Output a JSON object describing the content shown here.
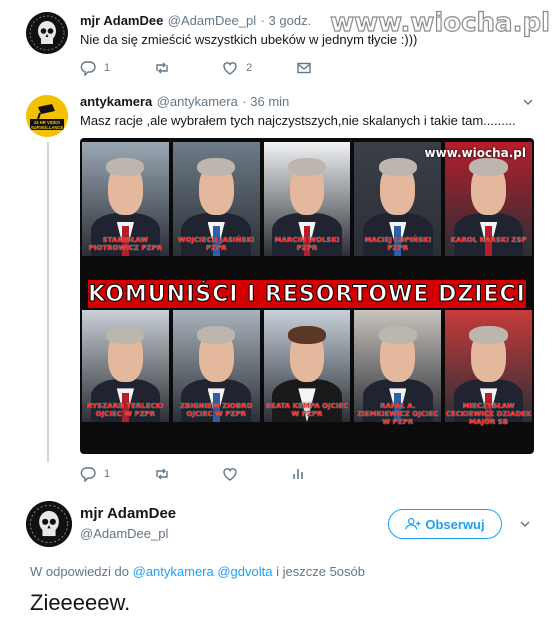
{
  "watermark": "www.wiocha.pl",
  "tweet1": {
    "name": "mjr AdamDee",
    "handle": "@AdamDee_pl",
    "time": "· 3 godz.",
    "text": "Nie da się zmieścić wszystkich ubeków w jednym tłycie :)))",
    "reply_count": "1",
    "like_count": "2"
  },
  "tweet2": {
    "name": "antykamera",
    "handle": "@antykamera",
    "time": "· 36 min",
    "text": "Masz racje ,ale wybrałem tych najczystszych,nie skalanych i takie tam.........",
    "avatar_text": "24 HR VIDEO SURVEILLANCE",
    "reply_count": "1",
    "image": {
      "watermark": "www.wiocha.pl",
      "banner": "KOMUNIŚCI I RESORTOWE DZIECI",
      "top_captions": [
        "STANISŁAW PIOTROWICZ PZPR",
        "WOJCIECH JASIŃSKI PZPR",
        "MARCIN WOLSKI PZPR",
        "MACIEJ ŁOPIŃSKI PZPR",
        "KAROL KARSKI ZSP"
      ],
      "bottom_captions": [
        "RYSZARD TERLECKI OJCIEC W PZPR",
        "ZBIGNIEW ZIOBRO OJCIEC W PZPR",
        "BEATA KEMPA OJCIEC W PZPR",
        "RAFAŁ A. ZIEMKIEWICZ OJCIEC W PZPR",
        "MIECZYSŁAW CECKIEWICZ DZIADEK MAJOR SB"
      ]
    }
  },
  "tweet3": {
    "name": "mjr AdamDee",
    "handle": "@AdamDee_pl",
    "follow_label": "Obserwuj",
    "reply_prefix": "W odpowiedzi do",
    "reply_to": "@antykamera @gdvolta",
    "reply_suffix": "i jeszcze 5osób",
    "text": "Zieeeeew."
  }
}
